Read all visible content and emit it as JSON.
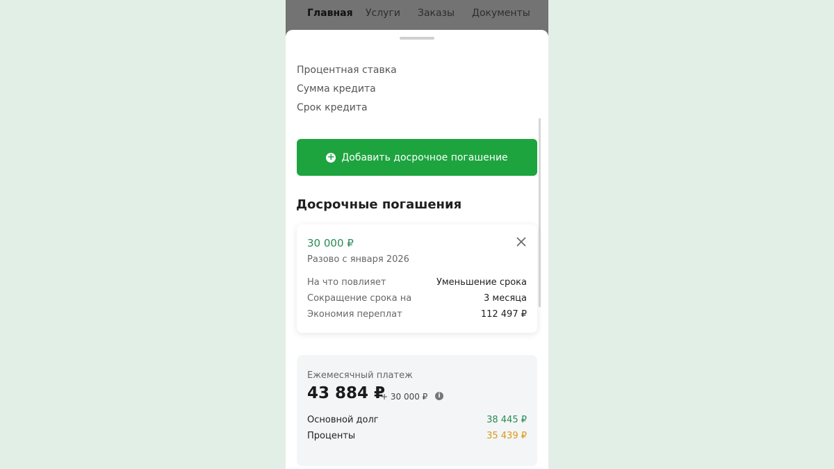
{
  "nav": {
    "tabs": [
      "Главная",
      "Услуги",
      "Заказы",
      "Документы"
    ]
  },
  "params": {
    "rate_label": "Процентная ставка",
    "amount_label": "Сумма кредита",
    "term_label": "Срок кредита"
  },
  "add_button": {
    "label": "Добавить досрочное погашение",
    "color": "#1da43f"
  },
  "early_section": {
    "title": "Досрочные погашения"
  },
  "payment_card": {
    "amount": "30 000 ₽",
    "subtitle": "Разово с января 2026",
    "rows": [
      {
        "label": "На что повлияет",
        "value": "Уменьшение срока"
      },
      {
        "label": "Сокращение срока на",
        "value": "3 месяца"
      },
      {
        "label": "Экономия переплат",
        "value": "112 497 ₽"
      }
    ],
    "close_icon": "close-icon"
  },
  "monthly": {
    "label": "Ежемесячный платеж",
    "total": "43 884 ₽",
    "extra": "+ 30 000 ₽",
    "info_icon": "info-icon",
    "rows": [
      {
        "label": "Основной долг",
        "value": "38 445 ₽",
        "color": "#2a8a53"
      },
      {
        "label": "Проценты",
        "value": "35 439 ₽",
        "color": "#d99a14"
      }
    ]
  }
}
